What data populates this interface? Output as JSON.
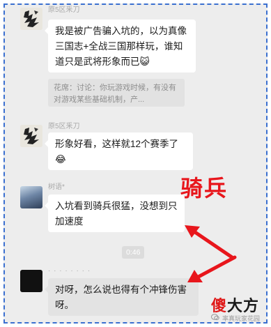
{
  "messages": [
    {
      "sender": "原5区釆刀",
      "text": "我是被广告骗入坑的，以为真像三国志+全战三国那样玩，谁知道只是武将形象而已",
      "emoji": "😺",
      "quote": "花席：讨论：你玩游戏时候，有没有对游戏某些基础机制，产..."
    },
    {
      "sender": "原5区釆刀",
      "text": "形象好看，这样就12个赛季了",
      "emoji": "😂"
    },
    {
      "sender": "树语*",
      "text": "入坑看到骑兵很猛，没想到只加速度"
    },
    {
      "sender": "· · · · · · · ·",
      "text": "对呀，怎么说也得有个冲锋伤害呀。"
    }
  ],
  "timestamp": "0:46",
  "annotation": "骑兵",
  "annotation_color": "#e8161c",
  "border_color": "#3a6fd0",
  "watermark": {
    "logo_red": "傻",
    "logo_black": "大方",
    "sub": "率真玩家花园"
  }
}
